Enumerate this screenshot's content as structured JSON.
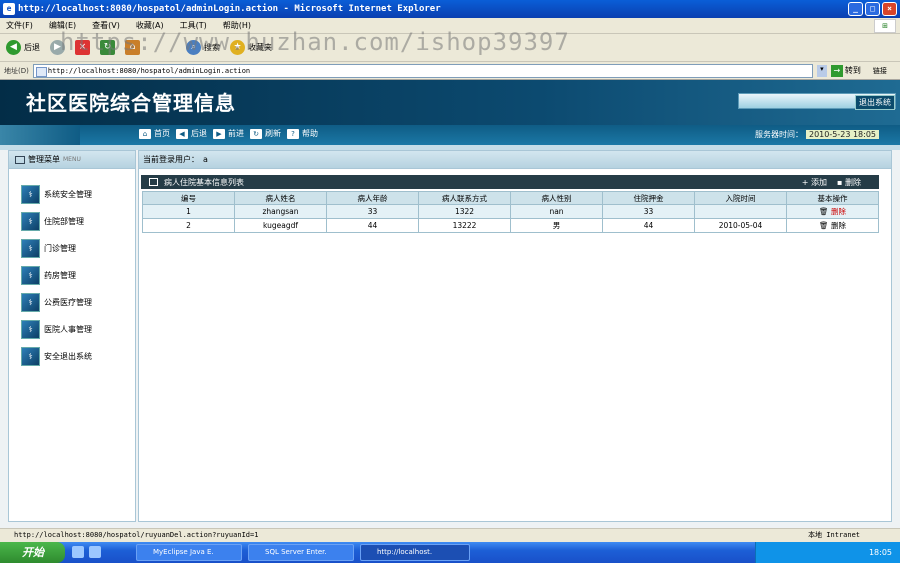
{
  "browser": {
    "title": "http://localhost:8080/hospatol/adminLogin.action - Microsoft Internet Explorer",
    "menu": [
      "文件(F)",
      "编辑(E)",
      "查看(V)",
      "收藏(A)",
      "工具(T)",
      "帮助(H)"
    ],
    "toolbar": {
      "back": "后退",
      "search": "搜索",
      "favorites": "收藏夹"
    },
    "address_label": "地址(D)",
    "address": "http://localhost:8080/hospatol/adminLogin.action",
    "go": "转到",
    "links": "链接"
  },
  "watermark": "https://www.huzhan.com/ishop39397",
  "app": {
    "title": "社区医院综合管理信息",
    "logout": "退出系统",
    "nav": [
      {
        "label": "首页",
        "icon": "home-icon"
      },
      {
        "label": "后退",
        "icon": "back-icon"
      },
      {
        "label": "前进",
        "icon": "forward-icon"
      },
      {
        "label": "刷新",
        "icon": "refresh-icon"
      },
      {
        "label": "帮助",
        "icon": "help-icon"
      }
    ],
    "server_time_label": "服务器时间：",
    "server_time": "2010-5-23 18:05"
  },
  "sidebar": {
    "header": "管理菜单",
    "header_sub": "MENU",
    "items": [
      "系统安全管理",
      "住院部管理",
      "门诊管理",
      "药房管理",
      "公费医疗管理",
      "医院人事管理",
      "安全退出系统"
    ]
  },
  "main": {
    "current_user_label": "当前登录用户：",
    "current_user": "a",
    "table_title": "病人住院基本信息列表",
    "add_label": "添加",
    "delete_label": "删除",
    "columns": [
      "编号",
      "病人姓名",
      "病人年龄",
      "病人联系方式",
      "病人性别",
      "住院押金",
      "入院时间",
      "基本操作"
    ],
    "rows": [
      [
        "1",
        "zhangsan",
        "33",
        "1322",
        "nan",
        "33",
        "",
        "删除"
      ],
      [
        "2",
        "kugeagdf",
        "44",
        "13222",
        "男",
        "44",
        "2010-05-04",
        "删除"
      ]
    ]
  },
  "status": {
    "url": "http://localhost:8080/hospatol/ruyuanDel.action?ruyuanId=1",
    "zone": "本地 Intranet"
  },
  "taskbar": {
    "start": "开始",
    "tasks": [
      "MyEclipse Java E.",
      "SQL Server Enter.",
      "http://localhost."
    ],
    "clock": "18:05"
  }
}
